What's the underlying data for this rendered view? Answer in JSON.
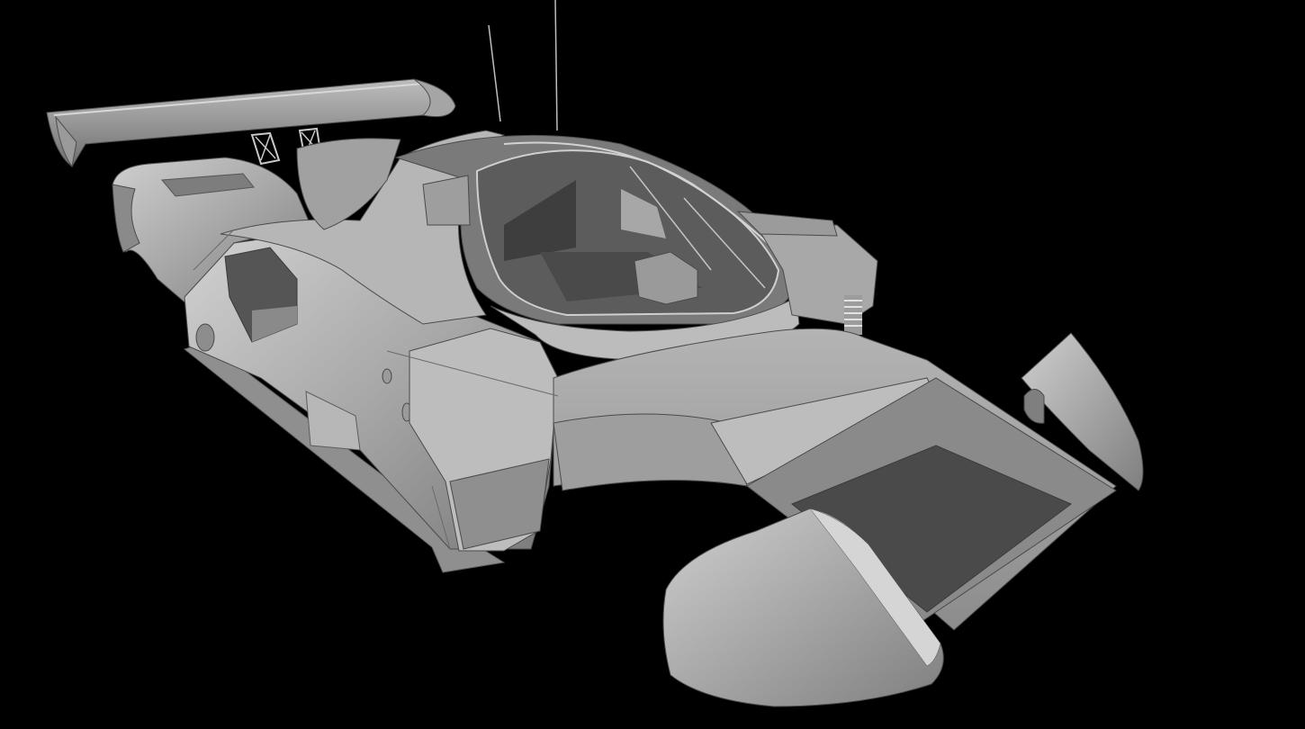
{
  "scene": {
    "subject": "race-car-body-3d-model",
    "render_style": "grey-shaded",
    "colors": {
      "background": "#000000",
      "body_light": "#c9c9c9",
      "body_mid": "#a6a6a6",
      "body_dark": "#6e6e6e",
      "floor_dark": "#4a4a4a",
      "edge": "#3a3a3a"
    }
  }
}
